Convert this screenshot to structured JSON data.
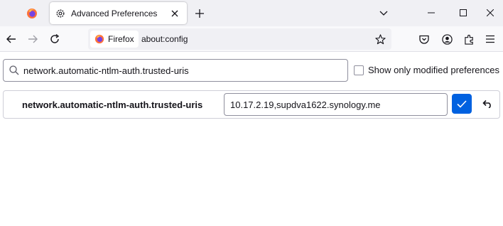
{
  "browser": {
    "pinned_tab_icon": "firefox-logo-icon",
    "tab": {
      "title": "Advanced Preferences",
      "icon": "gear-icon"
    },
    "new_tab_icon": "plus-icon",
    "tab_list_icon": "chevron-down-icon",
    "window_controls": [
      "minimize-icon",
      "maximize-icon",
      "close-icon"
    ]
  },
  "navbar": {
    "identity_label": "Firefox",
    "url": "about:config",
    "icons": [
      "back-arrow-icon",
      "forward-arrow-icon",
      "reload-icon",
      "bookmark-star-icon",
      "pocket-icon",
      "account-icon",
      "extensions-icon",
      "menu-icon"
    ]
  },
  "config": {
    "search_value": "network.automatic-ntlm-auth.trusted-uris",
    "show_modified_label": "Show only modified preferences",
    "show_modified_checked": false,
    "pref": {
      "name": "network.automatic-ntlm-auth.trusted-uris",
      "value": "10.17.2.19,supdva1622.synology.me"
    }
  },
  "colors": {
    "accent": "#0061e0",
    "tabstrip": "#f0f0f4",
    "navbar": "#f9f9fb"
  }
}
